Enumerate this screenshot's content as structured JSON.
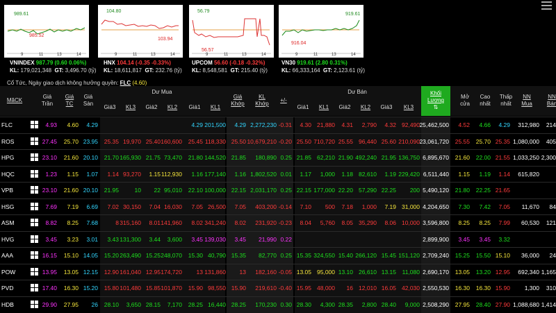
{
  "indices": [
    {
      "name": "VNINDEX",
      "price": "987.79",
      "change": "(0.60",
      "pct": "0.06%)",
      "dir": "up",
      "kl": "179,021,348",
      "gt": "3,496.70 (tỷ)",
      "high": "989.61",
      "low": "985.52",
      "ticks": [
        "9",
        "11",
        "13",
        "14"
      ]
    },
    {
      "name": "HNX",
      "price": "104.14",
      "change": "(-0.35",
      "pct": "-0.33%)",
      "dir": "down",
      "kl": "18,611,817",
      "gt": "232.76 (tỷ)",
      "high": "104.80",
      "low": "103.94",
      "ticks": [
        "9",
        "11",
        "13",
        "14"
      ]
    },
    {
      "name": "UPCOM",
      "price": "56.60",
      "change": "(-0.18",
      "pct": "-0.32%)",
      "dir": "down",
      "kl": "8,548,581",
      "gt": "215.40 (tỷ)",
      "high": "56.79",
      "low": "56.57",
      "ticks": [
        "9",
        "11",
        "13",
        "14"
      ]
    },
    {
      "name": "VN30",
      "price": "919.61",
      "change": "(2.80",
      "pct": "0.31%)",
      "dir": "up",
      "kl": "66,333,164",
      "gt": "2,123.61 (tỷ)",
      "high": "919.61",
      "low": "916.04",
      "ticks": [
        "9",
        "11",
        "13",
        "14"
      ]
    }
  ],
  "labels": {
    "kl": "KL:",
    "gt": "GT:"
  },
  "note": {
    "text": "Cổ Tức, Ngày giao dịch không hưởng quyền:",
    "sym": "FLC",
    "val": "(4.60)"
  },
  "header": {
    "mack": "MãCK",
    "tran": "Giá Trần",
    "tc": "Giá TC",
    "san": "Giá Sàn",
    "dumua": "Dư Mua",
    "duban": "Dư Bán",
    "gia3": "Giá3",
    "kl3": "KL3",
    "gia2": "Giá2",
    "kl2": "KL2",
    "gia1": "Giá1",
    "kl1": "KL1",
    "giakhop": "Giá Khớp",
    "klkhop": "KL Khớp",
    "pm": "+/-",
    "kl_luong": "Khối Lượng",
    "mocua": "Mở cửa",
    "caonhat": "Cao nhất",
    "thapnhat": "Thấp nhất",
    "nnmua": "NN Mua",
    "nnban": "NN Bán"
  },
  "rows": [
    {
      "sym": "FLC",
      "c": [
        "4.93",
        "4.60",
        "4.29",
        "",
        "",
        "",
        "",
        "4.29",
        "201,500",
        "4.29",
        "2,272,230",
        "-0.31",
        "4.30",
        "21,880",
        "4.31",
        "2,790",
        "4.32",
        "92,490",
        "25,462,500",
        "4.52",
        "4.66",
        "4.29",
        "312,980",
        "214"
      ],
      "k": [
        "m",
        "y",
        "c",
        "",
        "",
        "",
        "",
        "c",
        "c",
        "c",
        "c",
        "r",
        "r",
        "r",
        "r",
        "r",
        "r",
        "r",
        "w",
        "r",
        "g",
        "c",
        "w",
        "w"
      ]
    },
    {
      "sym": "ROS",
      "c": [
        "27.45",
        "25.70",
        "23.95",
        "25.35",
        "19,970",
        "25.40",
        "160,600",
        "25.45",
        "118,330",
        "25.50",
        "10,679,210",
        "-0.20",
        "25.50",
        "710,720",
        "25.55",
        "96,440",
        "25.60",
        "210,090",
        "23,061,720",
        "25.55",
        "25.70",
        "25.35",
        "1,080,000",
        "405"
      ],
      "k": [
        "m",
        "y",
        "c",
        "r",
        "r",
        "r",
        "r",
        "r",
        "r",
        "r",
        "r",
        "r",
        "r",
        "r",
        "r",
        "r",
        "r",
        "r",
        "w",
        "r",
        "y",
        "r",
        "w",
        "w"
      ]
    },
    {
      "sym": "HPG",
      "c": [
        "23.10",
        "21.60",
        "20.10",
        "21.70",
        "165,930",
        "21.75",
        "73,470",
        "21.80",
        "144,520",
        "21.85",
        "180,890",
        "0.25",
        "21.85",
        "62,210",
        "21.90",
        "492,240",
        "21.95",
        "136,750",
        "6,895,670",
        "21.60",
        "22.00",
        "21.55",
        "1,033,250",
        "2,300"
      ],
      "k": [
        "m",
        "y",
        "c",
        "g",
        "g",
        "g",
        "g",
        "g",
        "g",
        "g",
        "g",
        "g",
        "g",
        "g",
        "g",
        "g",
        "g",
        "g",
        "w",
        "y",
        "g",
        "r",
        "w",
        "w"
      ]
    },
    {
      "sym": "HQC",
      "c": [
        "1.23",
        "1.15",
        "1.07",
        "1.14",
        "93,270",
        "1.15",
        "112,930",
        "1.16",
        "177,140",
        "1.16",
        "1,802,520",
        "0.01",
        "1.17",
        "1,000",
        "1.18",
        "82,610",
        "1.19",
        "229,420",
        "6,511,440",
        "1.15",
        "1.19",
        "1.14",
        "615,820",
        ""
      ],
      "k": [
        "m",
        "y",
        "c",
        "r",
        "r",
        "y",
        "y",
        "g",
        "g",
        "g",
        "g",
        "g",
        "g",
        "g",
        "g",
        "g",
        "g",
        "g",
        "w",
        "y",
        "g",
        "r",
        "w",
        "w"
      ]
    },
    {
      "sym": "VPB",
      "c": [
        "23.10",
        "21.60",
        "20.10",
        "21.95",
        "10",
        "22",
        "95,010",
        "22.10",
        "100,000",
        "22.15",
        "2,031,170",
        "0.25",
        "22.15",
        "177,000",
        "22.20",
        "57,290",
        "22.25",
        "200",
        "5,490,120",
        "21.80",
        "22.25",
        "21.65",
        "",
        ""
      ],
      "k": [
        "m",
        "y",
        "c",
        "g",
        "g",
        "g",
        "g",
        "g",
        "g",
        "g",
        "g",
        "g",
        "g",
        "g",
        "g",
        "g",
        "g",
        "g",
        "w",
        "g",
        "g",
        "r",
        "w",
        "w"
      ]
    },
    {
      "sym": "HSG",
      "c": [
        "7.69",
        "7.19",
        "6.69",
        "7.02",
        "30,150",
        "7.04",
        "16,030",
        "7.05",
        "26,500",
        "7.05",
        "403,200",
        "-0.14",
        "7.10",
        "500",
        "7.18",
        "1,000",
        "7.19",
        "31,000",
        "4,204,650",
        "7.30",
        "7.42",
        "7.05",
        "11,670",
        "84"
      ],
      "k": [
        "m",
        "y",
        "c",
        "r",
        "r",
        "r",
        "r",
        "r",
        "r",
        "r",
        "r",
        "r",
        "r",
        "r",
        "r",
        "r",
        "y",
        "y",
        "w",
        "g",
        "g",
        "r",
        "w",
        "w"
      ]
    },
    {
      "sym": "ASM",
      "c": [
        "8.82",
        "8.25",
        "7.68",
        "8",
        "315,160",
        "8.01",
        "141,960",
        "8.02",
        "341,240",
        "8.02",
        "231,920",
        "-0.23",
        "8.04",
        "5,760",
        "8.05",
        "35,290",
        "8.06",
        "10,000",
        "3,596,800",
        "8.25",
        "8.25",
        "7.99",
        "60,530",
        "121"
      ],
      "k": [
        "m",
        "y",
        "c",
        "r",
        "r",
        "r",
        "r",
        "r",
        "r",
        "r",
        "r",
        "r",
        "r",
        "r",
        "r",
        "r",
        "r",
        "r",
        "w",
        "y",
        "y",
        "r",
        "w",
        "w"
      ]
    },
    {
      "sym": "HVG",
      "c": [
        "3.45",
        "3.23",
        "3.01",
        "3.43",
        "131,300",
        "3.44",
        "3,600",
        "3.45",
        "139,030",
        "3.45",
        "21,990",
        "0.22",
        "",
        "",
        "",
        "",
        "",
        "",
        "2,899,900",
        "3.45",
        "3.45",
        "3.32",
        "",
        ""
      ],
      "k": [
        "m",
        "y",
        "c",
        "g",
        "g",
        "g",
        "g",
        "m",
        "m",
        "m",
        "m",
        "m",
        "",
        "",
        "",
        "",
        "",
        "",
        "w",
        "m",
        "m",
        "g",
        "w",
        "w"
      ]
    },
    {
      "sym": "AAA",
      "c": [
        "16.15",
        "15.10",
        "14.05",
        "15.20",
        "263,490",
        "15.25",
        "248,070",
        "15.30",
        "40,790",
        "15.35",
        "82,770",
        "0.25",
        "15.35",
        "324,550",
        "15.40",
        "266,120",
        "15.45",
        "151,120",
        "2,709,240",
        "15.25",
        "15.50",
        "15.10",
        "36,000",
        "24"
      ],
      "k": [
        "m",
        "y",
        "c",
        "g",
        "g",
        "g",
        "g",
        "g",
        "g",
        "g",
        "g",
        "g",
        "g",
        "g",
        "g",
        "g",
        "g",
        "g",
        "w",
        "g",
        "g",
        "y",
        "w",
        "w"
      ]
    },
    {
      "sym": "POW",
      "c": [
        "13.95",
        "13.05",
        "12.15",
        "12.90",
        "161,040",
        "12.95",
        "174,720",
        "13",
        "131,860",
        "13",
        "182,160",
        "-0.05",
        "13.05",
        "95,000",
        "13.10",
        "26,610",
        "13.15",
        "11,080",
        "2,690,170",
        "13.05",
        "13.20",
        "12.95",
        "692,340",
        "1,165"
      ],
      "k": [
        "m",
        "y",
        "c",
        "r",
        "r",
        "r",
        "r",
        "r",
        "r",
        "r",
        "r",
        "r",
        "y",
        "y",
        "g",
        "g",
        "g",
        "g",
        "w",
        "y",
        "g",
        "r",
        "w",
        "w"
      ]
    },
    {
      "sym": "PVD",
      "c": [
        "17.40",
        "16.30",
        "15.20",
        "15.80",
        "101,480",
        "15.85",
        "101,870",
        "15.90",
        "98,550",
        "15.90",
        "219,610",
        "-0.40",
        "15.95",
        "48,000",
        "16",
        "12,010",
        "16.05",
        "42,030",
        "2,550,530",
        "16.30",
        "16.30",
        "15.90",
        "1,300",
        "310"
      ],
      "k": [
        "m",
        "y",
        "c",
        "r",
        "r",
        "r",
        "r",
        "r",
        "r",
        "r",
        "r",
        "r",
        "r",
        "r",
        "r",
        "r",
        "r",
        "r",
        "w",
        "y",
        "y",
        "r",
        "w",
        "w"
      ]
    },
    {
      "sym": "HDB",
      "c": [
        "29.90",
        "27.95",
        "26",
        "28.10",
        "3,650",
        "28.15",
        "7,170",
        "28.25",
        "16,440",
        "28.25",
        "170,230",
        "0.30",
        "28.30",
        "4,300",
        "28.35",
        "2,800",
        "28.40",
        "9,000",
        "2,508,290",
        "27.95",
        "28.40",
        "27.90",
        "1,088,680",
        "1,414"
      ],
      "k": [
        "m",
        "y",
        "c",
        "g",
        "g",
        "g",
        "g",
        "g",
        "g",
        "g",
        "g",
        "g",
        "g",
        "g",
        "g",
        "g",
        "g",
        "g",
        "w",
        "y",
        "g",
        "r",
        "w",
        "w"
      ]
    }
  ],
  "colors": {
    "up": "#1ee01e",
    "down": "#ff3b3b",
    "ref": "#f5e63c",
    "ceil": "#ff33ff",
    "floor": "#33d6ff",
    "highlight": "#1faa1f"
  }
}
